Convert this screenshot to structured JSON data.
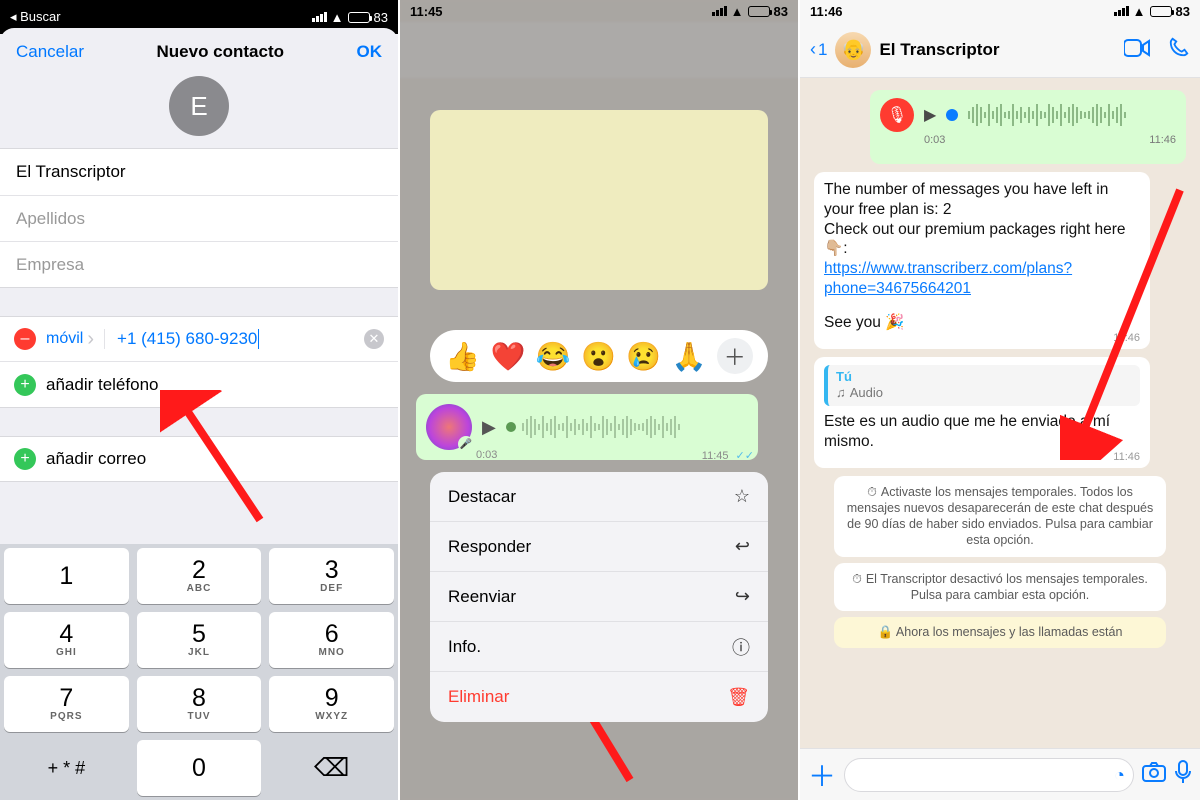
{
  "status": {
    "time2": "11:45",
    "time3": "11:46",
    "battery": "83",
    "search": "Buscar"
  },
  "p1": {
    "cancel": "Cancelar",
    "title": "Nuevo contacto",
    "ok": "OK",
    "initial": "E",
    "name": "El Transcriptor",
    "lastPH": "Apellidos",
    "companyPH": "Empresa",
    "ptype": "móvil",
    "phone": "+1 (415) 680-9230",
    "addPhone": "añadir teléfono",
    "addMail": "añadir correo",
    "keys": [
      [
        "1",
        ""
      ],
      [
        "2",
        "ABC"
      ],
      [
        "3",
        "DEF"
      ],
      [
        "4",
        "GHI"
      ],
      [
        "5",
        "JKL"
      ],
      [
        "6",
        "MNO"
      ],
      [
        "7",
        "PQRS"
      ],
      [
        "8",
        "TUV"
      ],
      [
        "9",
        "WXYZ"
      ]
    ],
    "sym": "+ * #",
    "zero": "0"
  },
  "p2": {
    "emojis": [
      "👍",
      "❤️",
      "😂",
      "😮",
      "😢",
      "🙏"
    ],
    "dur": "0:03",
    "time": "11:45",
    "menu": [
      {
        "l": "Destacar",
        "ic": "star"
      },
      {
        "l": "Responder",
        "ic": "reply"
      },
      {
        "l": "Reenviar",
        "ic": "fwd"
      },
      {
        "l": "Info.",
        "ic": "info"
      },
      {
        "l": "Eliminar",
        "ic": "trash",
        "red": true
      }
    ]
  },
  "p3": {
    "backN": "1",
    "name": "El Transcriptor",
    "vdur": "0:03",
    "vtime": "11:46",
    "msg1a": "The number of messages you have left in your free plan is: 2",
    "msg1b": "Check out our premium packages right here 👇🏼:",
    "msg1link": "https://www.transcriberz.com/plans?phone=34675664201",
    "msg1c": "See you 🎉",
    "msg1t": "11:46",
    "qwho": "Tú",
    "qwhat": "Audio",
    "msg2": "Este es un audio que me he enviado a mí mismo.",
    "msg2t": "11:46",
    "sys1": "Activaste los mensajes temporales. Todos los mensajes nuevos desaparecerán de este chat después de 90 días de haber sido enviados. Pulsa para cambiar esta opción.",
    "sys2": "El Transcriptor desactivó los mensajes temporales. Pulsa para cambiar esta opción.",
    "enc": "Ahora los mensajes y las llamadas están"
  }
}
